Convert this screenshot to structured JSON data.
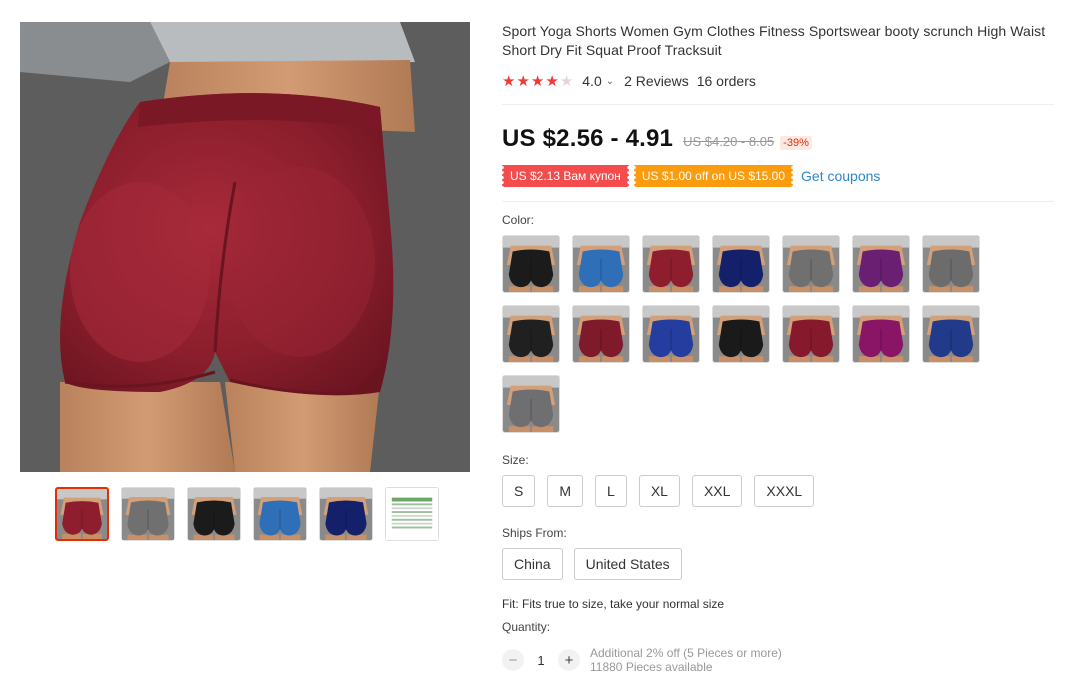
{
  "product": {
    "title": "Sport Yoga Shorts Women Gym Clothes Fitness Sportswear booty scrunch High Waist Short Dry Fit Squat Proof Tracksuit",
    "rating": "4.0",
    "rating_chevron": "⌄",
    "reviews": "2 Reviews",
    "orders": "16 orders",
    "stars": 4.0
  },
  "pricing": {
    "price": "US $2.56 - 4.91",
    "old_price": "US $4.20 - 8.05",
    "discount": "-39%"
  },
  "coupons": {
    "items": [
      "US $2.13 Вам купон",
      "US $1.00 off on US $15.00"
    ],
    "get_coupons": "Get coupons"
  },
  "color": {
    "label": "Color:",
    "swatches": [
      {
        "name": "black",
        "shorts": "#1b1b1b"
      },
      {
        "name": "blue",
        "shorts": "#2f6fb8"
      },
      {
        "name": "wine",
        "shorts": "#8e1e2e"
      },
      {
        "name": "navy",
        "shorts": "#15206b"
      },
      {
        "name": "gray",
        "shorts": "#707070"
      },
      {
        "name": "purple",
        "shorts": "#6a1f73"
      },
      {
        "name": "gray-v",
        "shorts": "#6c6c6c"
      },
      {
        "name": "black-v",
        "shorts": "#202020"
      },
      {
        "name": "wine-v",
        "shorts": "#7f1a2a"
      },
      {
        "name": "blue-v",
        "shorts": "#243d9e"
      },
      {
        "name": "black-stripe",
        "shorts": "#1a1a1a"
      },
      {
        "name": "wine-stripe",
        "shorts": "#861a2c"
      },
      {
        "name": "magenta",
        "shorts": "#8a1566"
      },
      {
        "name": "navy-v",
        "shorts": "#223a8a"
      },
      {
        "name": "gray-stripe",
        "shorts": "#6f6f72"
      }
    ]
  },
  "size": {
    "label": "Size:",
    "options": [
      "S",
      "M",
      "L",
      "XL",
      "XXL",
      "XXXL"
    ]
  },
  "ships": {
    "label": "Ships From:",
    "options": [
      "China",
      "United States"
    ]
  },
  "fit": "Fit: Fits true to size, take your normal size",
  "quantity": {
    "label": "Quantity:",
    "value": "1",
    "minus": "−",
    "plus": "+",
    "note_line1": "Additional 2% off (5 Pieces or more)",
    "note_line2": "11880 Pieces available"
  },
  "gallery": {
    "thumbs": [
      {
        "shorts": "#8e1e2e",
        "active": true
      },
      {
        "shorts": "#707070",
        "active": false
      },
      {
        "shorts": "#1b1b1b",
        "active": false
      },
      {
        "shorts": "#2f6fb8",
        "active": false
      },
      {
        "shorts": "#15206b",
        "active": false
      },
      {
        "shorts": "size-chart",
        "active": false
      }
    ]
  },
  "colors": {
    "accent": "#e62e04",
    "star": "#f03a3a",
    "link": "#2e87c8",
    "coupon_red": "#f44c4c",
    "coupon_orange": "#fb9b0e"
  }
}
